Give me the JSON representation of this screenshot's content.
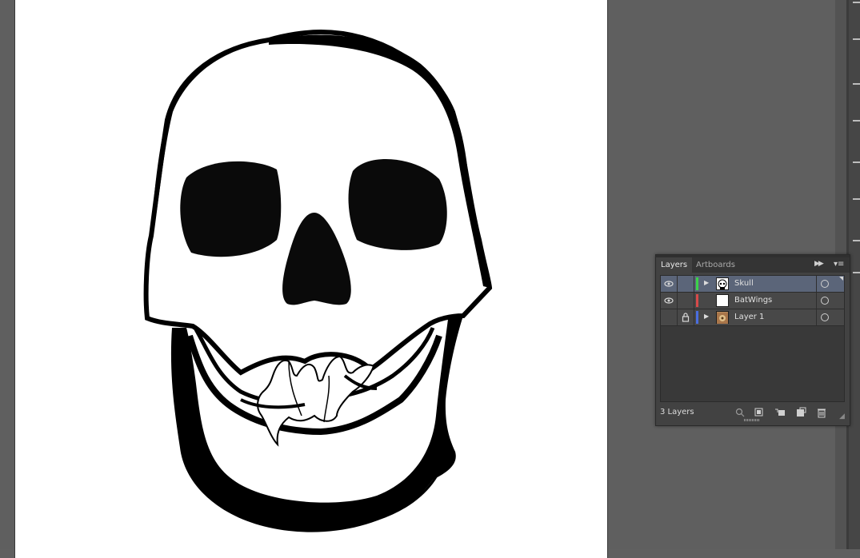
{
  "panel": {
    "tabs": [
      {
        "label": "Layers",
        "active": true
      },
      {
        "label": "Artboards",
        "active": false
      }
    ],
    "layers": [
      {
        "name": "Skull",
        "visible": true,
        "locked": false,
        "color": "#3cd24a",
        "expandable": true,
        "selected": true,
        "thumbnail": "skull-thumbnail"
      },
      {
        "name": "BatWings",
        "visible": true,
        "locked": false,
        "color": "#d74a4a",
        "expandable": false,
        "selected": false,
        "thumbnail": "blank-thumbnail"
      },
      {
        "name": "Layer 1",
        "visible": false,
        "locked": true,
        "color": "#4a6ee0",
        "expandable": true,
        "selected": false,
        "thumbnail": "image-thumbnail"
      }
    ],
    "layer_count": "3 Layers",
    "footer_icons": [
      "locate-object-icon",
      "make-clipping-mask-icon",
      "create-sublayer-icon",
      "create-layer-icon",
      "trash-icon"
    ]
  },
  "colors": {
    "pasteboard": "#5f5f5f",
    "artboard": "#ffffff",
    "panel_bg": "#424242",
    "selection": "#5b6579"
  }
}
